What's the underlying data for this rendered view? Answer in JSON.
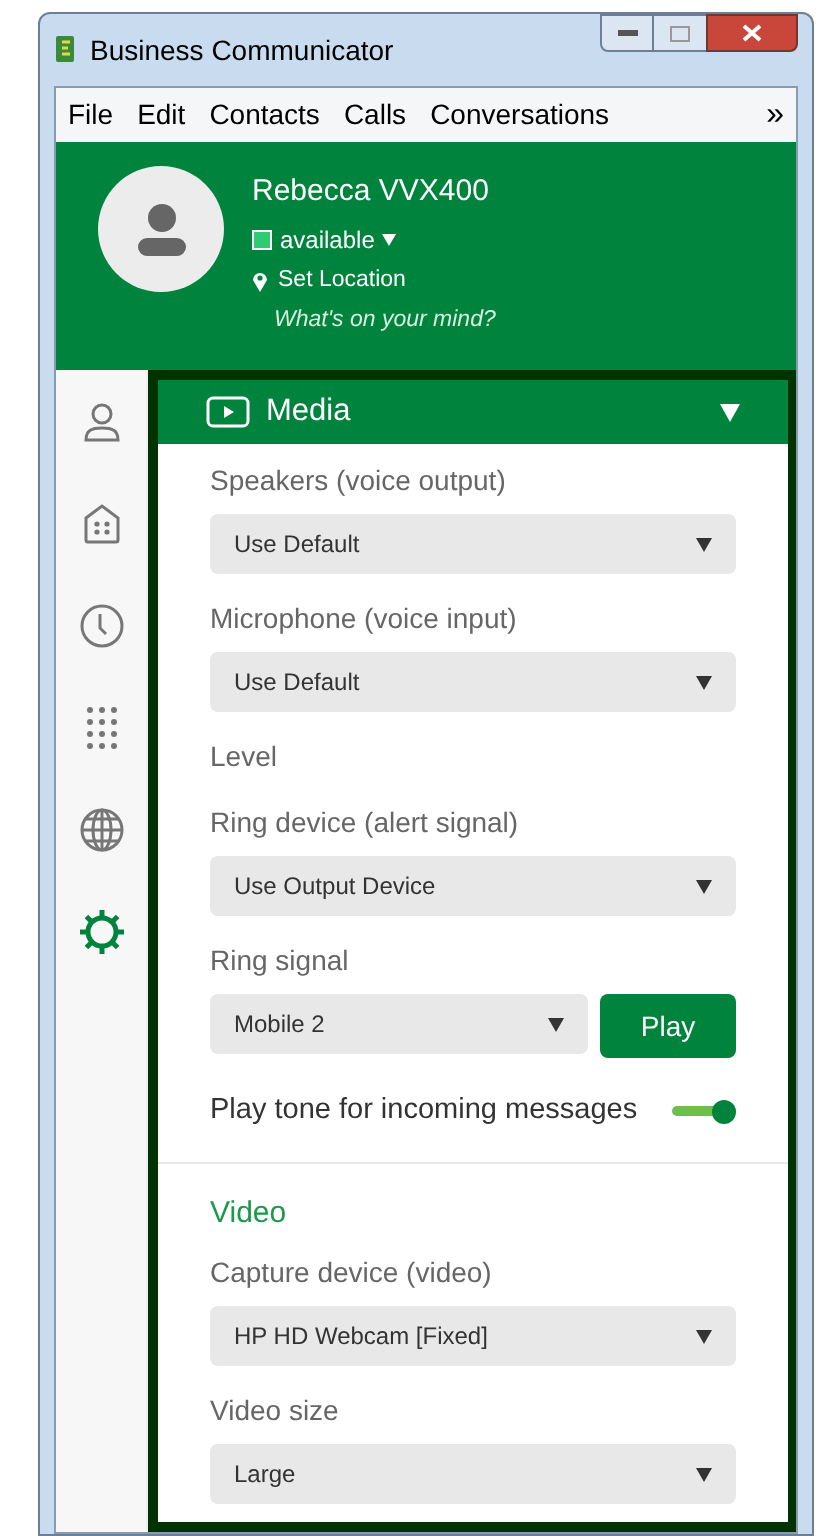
{
  "window": {
    "title": "Business Communicator"
  },
  "menu": [
    "File",
    "Edit",
    "Contacts",
    "Calls",
    "Conversations"
  ],
  "menu_overflow": "»",
  "profile": {
    "name": "Rebecca VVX400",
    "presence": "available",
    "location": "Set Location",
    "mood_placeholder": "What's on your mind?"
  },
  "sidebar": {
    "items": [
      {
        "kind": "contact",
        "selected": false
      },
      {
        "kind": "directory",
        "selected": false
      },
      {
        "kind": "history",
        "selected": false
      },
      {
        "kind": "dialpad",
        "selected": false
      },
      {
        "kind": "web",
        "selected": false
      },
      {
        "kind": "settings",
        "selected": true
      }
    ]
  },
  "panel": {
    "title": "Media",
    "expanded": true,
    "items": [
      {
        "kind": "select",
        "label": "Speakers (voice output)",
        "value": "Use Default"
      },
      {
        "kind": "select",
        "label": "Microphone (voice input)",
        "value": "Use Default"
      },
      {
        "kind": "label",
        "label": "Level"
      },
      {
        "kind": "select",
        "label": "Ring device (alert signal)",
        "value": "Use Output Device"
      },
      {
        "kind": "select_button",
        "label": "Ring signal",
        "value": "Mobile 2",
        "button": "Play"
      },
      {
        "kind": "toggle",
        "label": "Play tone for incoming messages",
        "on": true
      },
      {
        "kind": "divider"
      },
      {
        "kind": "heading",
        "label": "Video"
      },
      {
        "kind": "select",
        "label": "Capture device (video)",
        "value": "HP HD Webcam [Fixed]"
      },
      {
        "kind": "select",
        "label": "Video size",
        "value": "Large"
      }
    ]
  }
}
